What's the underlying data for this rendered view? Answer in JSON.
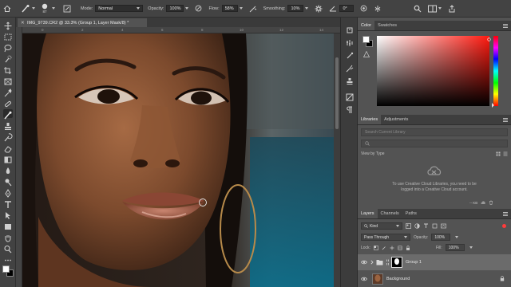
{
  "options_bar": {
    "brush_size": "87",
    "mode_label": "Mode:",
    "mode_value": "Normal",
    "opacity_label": "Opacity:",
    "opacity_value": "100%",
    "flow_label": "Flow:",
    "flow_value": "58%",
    "smoothing_label": "Smoothing:",
    "smoothing_value": "10%",
    "angle_value": "0°"
  },
  "document": {
    "tab_title": "IMG_9739.CR2 @ 33.3% (Group 1, Layer Mask/8) *",
    "ruler_ticks": [
      "0",
      "2",
      "4",
      "6",
      "8",
      "10",
      "12",
      "14"
    ]
  },
  "color_panel": {
    "tabs": [
      "Color",
      "Swatches"
    ],
    "active_tab": "Color",
    "foreground": "#ffffff",
    "background": "#000000",
    "hue_color": "#ff1a10"
  },
  "libraries_panel": {
    "tabs": [
      "Libraries",
      "Adjustments"
    ],
    "active_tab": "Libraries",
    "search_placeholder": "Search Current Library",
    "view_by": "View by Type",
    "message": "To use Creative Cloud Libraries, you need to be logged into a Creative Cloud account.",
    "size_label": "-- KB"
  },
  "layers_panel": {
    "tabs": [
      "Layers",
      "Channels",
      "Paths"
    ],
    "active_tab": "Layers",
    "kind_label": "Kind",
    "blend_mode": "Pass Through",
    "opacity_label": "Opacity:",
    "opacity_value": "100%",
    "lock_label": "Lock:",
    "fill_label": "Fill:",
    "fill_value": "100%",
    "layers": [
      {
        "name": "Group 1",
        "selected": true
      },
      {
        "name": "Background",
        "selected": false
      }
    ]
  }
}
